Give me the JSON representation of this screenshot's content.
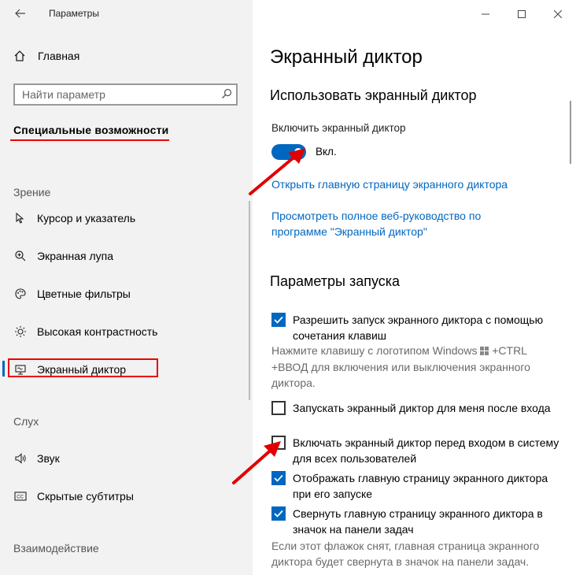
{
  "window": {
    "title": "Параметры",
    "back_icon": "back-arrow-icon",
    "minimize_icon": "minimize-icon",
    "maximize_icon": "maximize-icon",
    "close_icon": "close-icon"
  },
  "sidebar": {
    "home_label": "Главная",
    "search_placeholder": "Найти параметр",
    "category": "Специальные возможности",
    "sections": [
      {
        "title": "Зрение",
        "items": [
          {
            "label": "Курсор и указатель",
            "icon": "cursor-icon"
          },
          {
            "label": "Экранная лупа",
            "icon": "magnifier-icon"
          },
          {
            "label": "Цветные фильтры",
            "icon": "palette-icon"
          },
          {
            "label": "Высокая контрастность",
            "icon": "contrast-icon"
          },
          {
            "label": "Экранный диктор",
            "icon": "narrator-icon",
            "selected": true
          }
        ]
      },
      {
        "title": "Слух",
        "items": [
          {
            "label": "Звук",
            "icon": "speaker-icon"
          },
          {
            "label": "Скрытые субтитры",
            "icon": "captions-icon"
          }
        ]
      },
      {
        "title": "Взаимодействие",
        "items": []
      }
    ]
  },
  "main": {
    "page_title": "Экранный диктор",
    "use_heading": "Использовать экранный диктор",
    "toggle_label": "Включить экранный диктор",
    "toggle_state": "Вкл.",
    "toggle_on": true,
    "link_home": "Открыть главную страницу экранного диктора",
    "link_guide": "Просмотреть полное веб-руководство по программе \"Экранный диктор\"",
    "startup_heading": "Параметры запуска",
    "options": [
      {
        "label": "Разрешить запуск экранного диктора с помощью сочетания клавиш",
        "checked": true
      },
      {
        "label": "Запускать экранный диктор для меня после входа",
        "checked": false
      },
      {
        "label": "Включать экранный диктор перед входом в систему для всех пользователей",
        "checked": false
      },
      {
        "label": "Отображать главную страницу экранного диктора при его запуске",
        "checked": true
      },
      {
        "label": "Свернуть главную страницу экранного диктора в значок на панели задач",
        "checked": true
      }
    ],
    "shortcut_desc_before": "Нажмите клавишу с логотипом Windows",
    "shortcut_desc_after": "+CTRL +ВВОД для включения или выключения экранного диктора.",
    "minimize_desc": "Если этот флажок снят, главная страница экранного диктора будет свернута в значок на панели задач."
  },
  "colors": {
    "accent": "#0067c0",
    "annotation_red": "#e00000",
    "sidebar_bg": "#f2f2f2"
  }
}
